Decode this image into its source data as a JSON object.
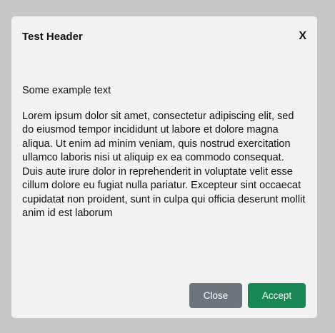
{
  "modal": {
    "title": "Test Header",
    "close_icon_label": "X",
    "intro_text": "Some example text",
    "body_text": "Lorem ipsum dolor sit amet, consectetur adipiscing elit, sed do eiusmod tempor incididunt ut labore et dolore magna aliqua. Ut enim ad minim veniam, quis nostrud exercitation ullamco laboris nisi ut aliquip ex ea commodo consequat. Duis aute irure dolor in reprehenderit in voluptate velit esse cillum dolore eu fugiat nulla pariatur. Excepteur sint occaecat cupidatat non proident, sunt in culpa qui officia deserunt mollit anim id est laborum",
    "buttons": {
      "close_label": "Close",
      "accept_label": "Accept"
    }
  },
  "colors": {
    "backdrop": "#c6c6c6",
    "modal_background": "#f2f2f2",
    "close_button": "#6c757d",
    "accept_button": "#198754"
  }
}
